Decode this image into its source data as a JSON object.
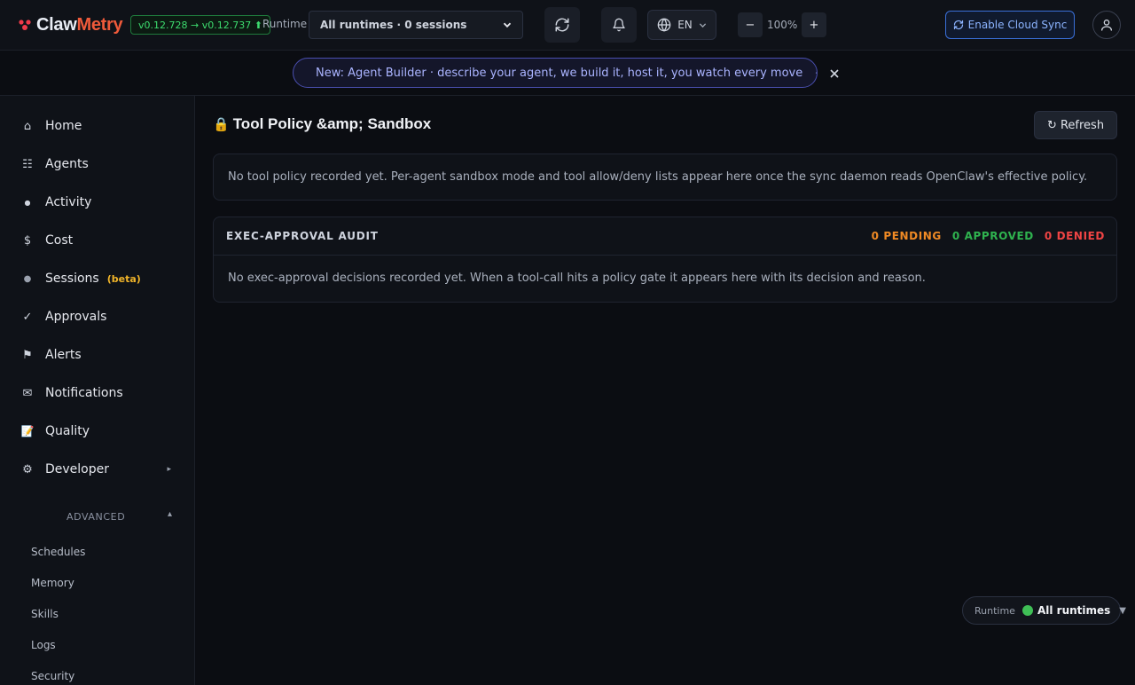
{
  "header": {
    "logo_part1": "Claw",
    "logo_part2": "Metry",
    "version_badge": "v0.12.728 → v0.12.737 ⬆",
    "runtime_label": "Runtime",
    "runtime_select_value": "All runtimes · 0 sessions",
    "language": "EN",
    "zoom_minus": "−",
    "zoom_level": "100%",
    "zoom_plus": "+",
    "cloud_sync_label": "Enable Cloud Sync"
  },
  "banner": {
    "text": "New: Agent Builder · describe your agent, we build it, host it, you watch every move",
    "arrow": "→",
    "close": "×"
  },
  "sidebar": {
    "items": [
      {
        "icon": "home-icon",
        "glyph": "⌂",
        "label": "Home"
      },
      {
        "icon": "agents-icon",
        "glyph": "☷",
        "label": "Agents"
      },
      {
        "icon": "activity-icon",
        "glyph": "●",
        "label": "Activity"
      },
      {
        "icon": "cost-icon",
        "glyph": "$",
        "label": "Cost"
      },
      {
        "icon": "sessions-icon",
        "glyph": "●",
        "label": "Sessions",
        "badge": "(beta)"
      },
      {
        "icon": "approvals-icon",
        "glyph": "✓",
        "label": "Approvals"
      },
      {
        "icon": "alerts-icon",
        "glyph": "⚑",
        "label": "Alerts"
      },
      {
        "icon": "notifications-icon",
        "glyph": "✉",
        "label": "Notifications"
      },
      {
        "icon": "quality-icon",
        "glyph": "📝",
        "label": "Quality"
      },
      {
        "icon": "developer-icon",
        "glyph": "⚙",
        "label": "Developer",
        "caret": "▸"
      }
    ],
    "advanced_label": "ADVANCED",
    "advanced_caret": "▴",
    "advanced_items": [
      "Schedules",
      "Memory",
      "Skills",
      "Logs",
      "Security"
    ]
  },
  "main": {
    "title_icon": "🔒",
    "title": "Tool Policy &amp; Sandbox",
    "refresh_label": "↻ Refresh",
    "policy_empty": "No tool policy recorded yet. Per-agent sandbox mode and tool allow/deny lists appear here once the sync daemon reads OpenClaw's effective policy.",
    "audit": {
      "title": "EXEC-APPROVAL AUDIT",
      "pending": "0 PENDING",
      "approved": "0 APPROVED",
      "denied": "0 DENIED",
      "empty": "No exec-approval decisions recorded yet. When a tool-call hits a policy gate it appears here with its decision and reason."
    }
  },
  "runtime_pill": {
    "label": "Runtime",
    "value": "All runtimes",
    "caret": "▼"
  },
  "colors": {
    "accent_orange": "#ef5a3a",
    "pending": "#f08a24",
    "approved": "#2fb34f",
    "denied": "#ef4444",
    "beta": "#f0b429"
  }
}
